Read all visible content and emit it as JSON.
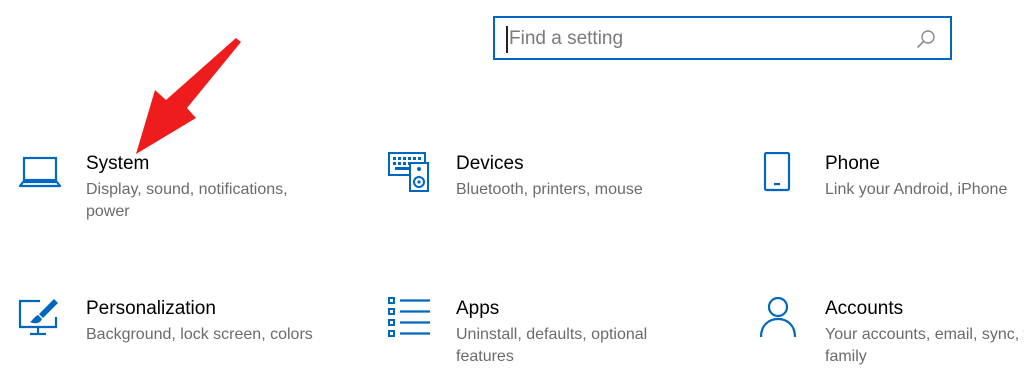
{
  "search": {
    "placeholder": "Find a setting",
    "value": ""
  },
  "tiles": [
    {
      "icon": "laptop-icon",
      "title": "System",
      "description": "Display, sound, notifications, power"
    },
    {
      "icon": "keyboard-speaker-icon",
      "title": "Devices",
      "description": "Bluetooth, printers, mouse"
    },
    {
      "icon": "phone-icon",
      "title": "Phone",
      "description": "Link your Android, iPhone"
    },
    {
      "icon": "paintbrush-monitor-icon",
      "title": "Personalization",
      "description": "Background, lock screen, colors"
    },
    {
      "icon": "apps-list-icon",
      "title": "Apps",
      "description": "Uninstall, defaults, optional features"
    },
    {
      "icon": "person-icon",
      "title": "Accounts",
      "description": "Your accounts, email, sync, work, family"
    }
  ],
  "colors": {
    "accent": "#0067c0",
    "annotation_arrow": "#ee1c1c"
  }
}
